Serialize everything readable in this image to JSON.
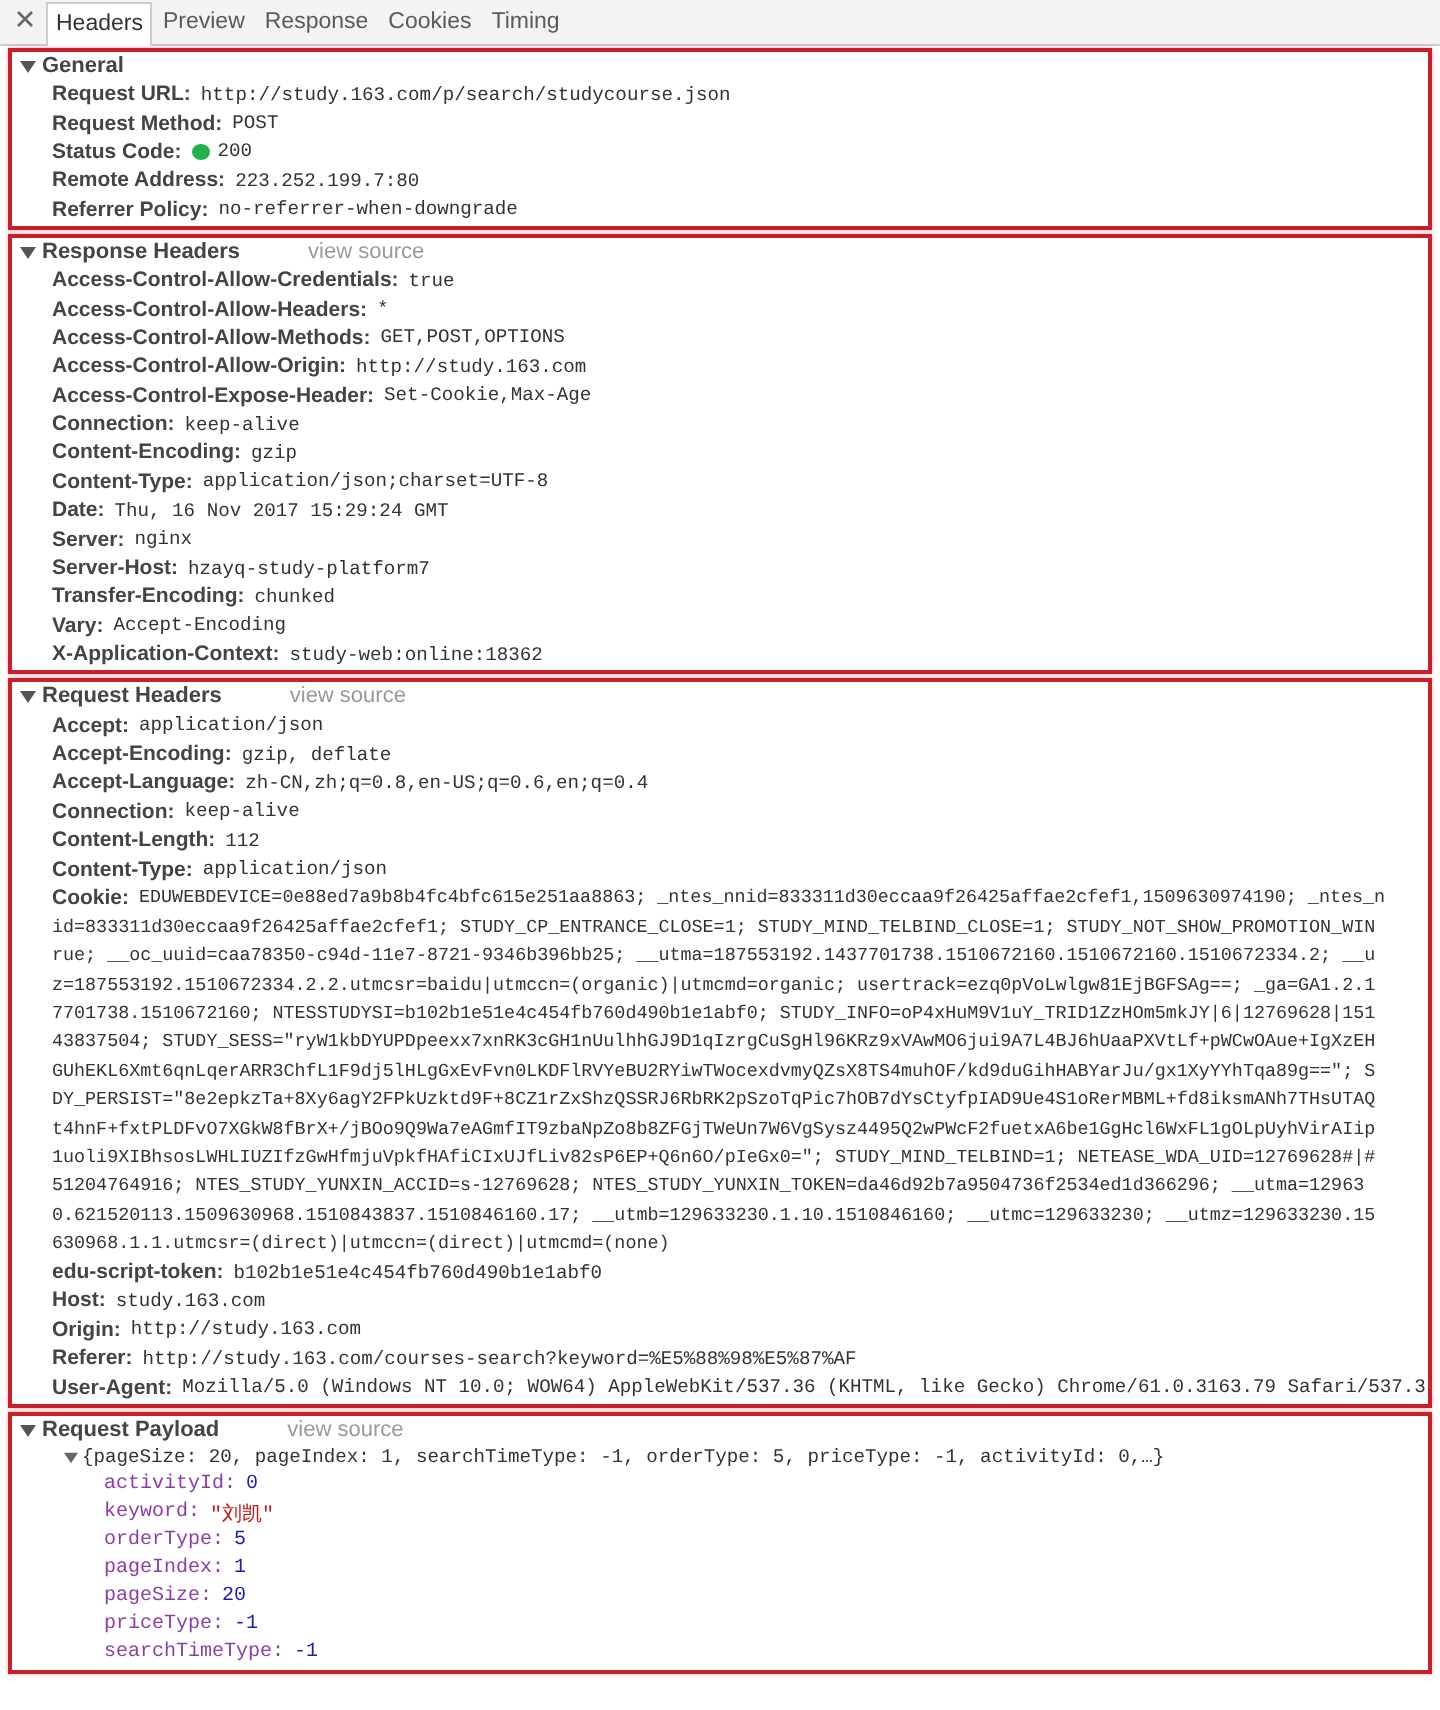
{
  "tabs": [
    {
      "label": "Headers",
      "selected": true
    },
    {
      "label": "Preview",
      "selected": false
    },
    {
      "label": "Response",
      "selected": false
    },
    {
      "label": "Cookies",
      "selected": false
    },
    {
      "label": "Timing",
      "selected": false
    }
  ],
  "sections": [
    {
      "kind": "headers",
      "title": "General",
      "expanded": true,
      "rows": [
        {
          "name": "Request URL:",
          "value": "http://study.163.com/p/search/studycourse.json"
        },
        {
          "name": "Request Method:",
          "value": "POST"
        },
        {
          "name": "Status Code:",
          "value": "200",
          "color": "#22b14c"
        },
        {
          "name": "Remote Address:",
          "value": "223.252.199.7:80"
        },
        {
          "name": "Referrer Policy:",
          "value": "no-referrer-when-downgrade"
        }
      ]
    },
    {
      "kind": "headers",
      "title": "Response Headers",
      "link": "view source",
      "expanded": true,
      "rows": [
        {
          "name": "Access-Control-Allow-Credentials:",
          "value": "true"
        },
        {
          "name": "Access-Control-Allow-Headers:",
          "value": "*"
        },
        {
          "name": "Access-Control-Allow-Methods:",
          "value": "GET,POST,OPTIONS"
        },
        {
          "name": "Access-Control-Allow-Origin:",
          "value": "http://study.163.com"
        },
        {
          "name": "Access-Control-Expose-Header:",
          "value": "Set-Cookie,Max-Age"
        },
        {
          "name": "Connection:",
          "value": "keep-alive"
        },
        {
          "name": "Content-Encoding:",
          "value": "gzip"
        },
        {
          "name": "Content-Type:",
          "value": "application/json;charset=UTF-8"
        },
        {
          "name": "Date:",
          "value": "Thu, 16 Nov 2017 15:29:24 GMT"
        },
        {
          "name": "Server:",
          "value": "nginx"
        },
        {
          "name": "Server-Host:",
          "value": "hzayq-study-platform7"
        },
        {
          "name": "Transfer-Encoding:",
          "value": "chunked"
        },
        {
          "name": "Vary:",
          "value": "Accept-Encoding"
        },
        {
          "name": "X-Application-Context:",
          "value": "study-web:online:18362"
        }
      ]
    },
    {
      "kind": "headers",
      "title": "Request Headers",
      "link": "view source",
      "expanded": true,
      "rows": [
        {
          "name": "Accept:",
          "value": "application/json"
        },
        {
          "name": "Accept-Encoding:",
          "value": "gzip, deflate"
        },
        {
          "name": "Accept-Language:",
          "value": "zh-CN,zh;q=0.8,en-US;q=0.6,en;q=0.4"
        },
        {
          "name": "Connection:",
          "value": "keep-alive"
        },
        {
          "name": "Content-Length:",
          "value": "112"
        },
        {
          "name": "Content-Type:",
          "value": "application/json"
        },
        {
          "name": "Cookie:",
          "value_lines": [
            "EDUWEBDEVICE=0e88ed7a9b8b4fc4bfc615e251aa8863; _ntes_nnid=833311d30eccaa9f26425affae2cfef1,1509630974190; _ntes_n",
            "id=833311d30eccaa9f26425affae2cfef1; STUDY_CP_ENTRANCE_CLOSE=1; STUDY_MIND_TELBIND_CLOSE=1; STUDY_NOT_SHOW_PROMOTION_WIN",
            "rue; __oc_uuid=caa78350-c94d-11e7-8721-9346b396bb25; __utma=187553192.1437701738.1510672160.1510672160.1510672334.2; __u",
            "z=187553192.1510672334.2.2.utmcsr=baidu|utmccn=(organic)|utmcmd=organic; usertrack=ezq0pVoLwlgw81EjBGFSAg==; _ga=GA1.2.1",
            "7701738.1510672160; NTESSTUDYSI=b102b1e51e4c454fb760d490b1e1abf0; STUDY_INFO=oP4xHuM9V1uY_TRID1ZzHOm5mkJY|6|12769628|151",
            "43837504; STUDY_SESS=\"ryW1kbDYUPDpeexx7xnRK3cGH1nUulhhGJ9D1qIzrgCuSgHl96KRz9xVAwMO6jui9A7L4BJ6hUaaPXVtLf+pWCwOAue+IgXzEH",
            "GUhEKL6Xmt6qnLqerARR3ChfL1F9dj5lHLgGxEvFvn0LKDFlRVYeBU2RYiwTWocexdvmyQZsX8TS4muhOF/kd9duGihHABYarJu/gx1XyYYhTqa89g==\"; S",
            "DY_PERSIST=\"8e2epkzTa+8Xy6agY2FPkUzktd9F+8CZ1rZxShzQSSRJ6RbRK2pSzoTqPic7hOB7dYsCtyfpIAD9Ue4S1oRerMBML+fd8iksmANh7THsUTAQ",
            "t4hnF+fxtPLDFvO7XGkW8fBrX+/jBOo9Q9Wa7eAGmfIT9zbaNpZo8b8ZFGjTWeUn7W6VgSysz4495Q2wPWcF2fuetxA6be1GgHcl6WxFL1gOLpUyhVirAIip",
            "1uoli9XIBhsosLWHLIUZIfzGwHfmjuVpkfHAfiCIxUJfLiv82sP6EP+Q6n6O/pIeGx0=\"; STUDY_MIND_TELBIND=1; NETEASE_WDA_UID=12769628#|#",
            "51204764916; NTES_STUDY_YUNXIN_ACCID=s-12769628; NTES_STUDY_YUNXIN_TOKEN=da46d92b7a9504736f2534ed1d366296; __utma=12963",
            "0.621520113.1509630968.1510843837.1510846160.17; __utmb=129633230.1.10.1510846160; __utmc=129633230; __utmz=129633230.15",
            "630968.1.1.utmcsr=(direct)|utmccn=(direct)|utmcmd=(none)"
          ]
        },
        {
          "name": "edu-script-token:",
          "value": "b102b1e51e4c454fb760d490b1e1abf0"
        },
        {
          "name": "Host:",
          "value": "study.163.com"
        },
        {
          "name": "Origin:",
          "value": "http://study.163.com"
        },
        {
          "name": "Referer:",
          "value": "http://study.163.com/courses-search?keyword=%E5%88%98%E5%87%AF"
        },
        {
          "name": "User-Agent:",
          "value": "Mozilla/5.0 (Windows NT 10.0; WOW64) AppleWebKit/537.36 (KHTML, like Gecko) Chrome/61.0.3163.79 Safari/537.3"
        }
      ]
    },
    {
      "kind": "payload",
      "title": "Request Payload",
      "link": "view source",
      "expanded": true,
      "summary": "{pageSize: 20, pageIndex: 1, searchTimeType: -1, orderType: 5, priceType: -1, activityId: 0,…}",
      "summary_expanded": true,
      "properties": [
        {
          "name": "activityId:",
          "value": "0",
          "kind": "number"
        },
        {
          "name": "keyword:",
          "value": "\"刘凯\"",
          "kind": "string"
        },
        {
          "name": "orderType:",
          "value": "5",
          "kind": "number"
        },
        {
          "name": "pageIndex:",
          "value": "1",
          "kind": "number"
        },
        {
          "name": "pageSize:",
          "value": "20",
          "kind": "number"
        },
        {
          "name": "priceType:",
          "value": "-1",
          "kind": "number"
        },
        {
          "name": "searchTimeType:",
          "value": "-1",
          "kind": "number"
        }
      ]
    }
  ]
}
